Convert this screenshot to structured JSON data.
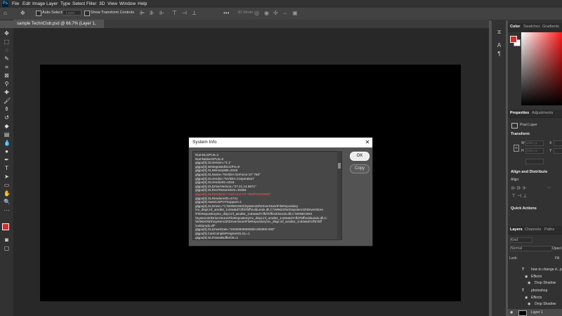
{
  "app": {
    "logo": "Ps",
    "menus": [
      "File",
      "Edit",
      "Image",
      "Layer",
      "Type",
      "Select",
      "Filter",
      "3D",
      "View",
      "Window",
      "Help"
    ]
  },
  "options_bar": {
    "auto_select_label": "Auto-Select:",
    "auto_select_value": "Layer",
    "show_transform_label": "Show Transform Controls",
    "mode_label": "3D Mode:"
  },
  "document": {
    "tab_title": "sample TechnClub.psd @ 66.7% (Layer 1, RGB/8) *"
  },
  "right_panels": {
    "color_tabs": [
      "Color",
      "Swatches",
      "Gradients"
    ],
    "prop_tabs": [
      "Properties",
      "Adjustments"
    ],
    "pixel_layer": "Pixel Layer",
    "transform": "Transform",
    "w_label": "W",
    "h_label": "H",
    "x_label": "X",
    "y_label": "Y",
    "w_placeholder": "1066 px",
    "h_placeholder": "1066 px",
    "align": "Align and Distribute",
    "align_sub": "Align:",
    "quick_actions": "Quick Actions",
    "layer_tabs": [
      "Layers",
      "Channels",
      "Paths"
    ],
    "kind": "Kind",
    "blend_mode": "Normal",
    "opacity": "Opaci",
    "lock": "Lock:",
    "fill": "Fill",
    "layers": [
      {
        "name": "how to change d...p",
        "type": "T"
      },
      {
        "name": "Effects",
        "type": "fx"
      },
      {
        "name": "Drop Shadow",
        "type": "eff"
      },
      {
        "name": "photoshop",
        "type": "T"
      },
      {
        "name": "Effects",
        "type": "fx"
      },
      {
        "name": "Drop Shadow",
        "type": "eff"
      },
      {
        "name": "Layer 1",
        "type": "px"
      }
    ]
  },
  "dialog": {
    "title": "System Info",
    "ok_label": "OK",
    "copy_label": "Copy",
    "lines": [
      "NumGLGPUs=1",
      "NumNativeGPUs=0",
      "glgpu[0].GLVersion=\"2.1\"",
      "glgpu[0].IsIntegratedGLGPU=0",
      "glgpu[0].GLMemoryMB=2048",
      "glgpu[0].GLName=\"NVIDIA GeForce GT 750\"",
      "glgpu[0].GLVendor=\"NVIDIA Corporation\"",
      "glgpu[0].GLVendorID=4318",
      "glgpu[0].GLDriverVersion=\"27.21.14.5671\"",
      "glgpu[0].GLRectTextureSize=16384",
      "glgpu[0].GLRenderer=\"GeForce GT 750/PCIe/SSE2\"",
      "glgpu[0].GLRendererID=4741",
      "glgpu[0].HasGLNPOTSupport=1",
      "glgpu[0].GLDriver=\"C:\\WINDOWS\\System32\\DriverStore\\FileRepository",
      "\\nv_dispi.inf_amd64_1c83a5d7cffd7bff\\nvldumdx.dll,C:\\WINDOWS\\System32\\DriverStore",
      "\\FileRepository\\nv_dispi.inf_amd64_1c83a5d7cffd7bff\\nvldumdx.dll,C:\\WINDOWS",
      "\\System32\\DriverStore\\FileRepository\\nv_dispi.inf_amd64_1c83a5d7cffd7bff\\nvldumdx.dll,C:",
      "\\WINDOWS\\System32\\DriverStore\\FileRepository\\nv_dispi.inf_amd64_1c83a5d7cffd7bff",
      "\\nvldumdx.dll\"",
      "glgpu[0].GLDriverDate=\"20200930000000.000000-000\"",
      "glgpu[0].CanCompileProgramGLSL=1",
      "glgpu[0].GLFrameBufferOK=1"
    ]
  },
  "colors": {
    "foreground": "#d92b2b",
    "background": "#ffffff",
    "highlight_line": "#ff5a5a"
  }
}
